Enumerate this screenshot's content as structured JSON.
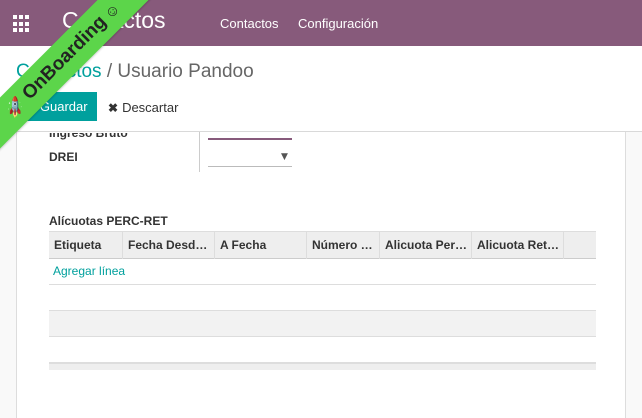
{
  "topbar": {
    "brand": "Contactos",
    "menu": [
      "Contactos",
      "Configuración"
    ]
  },
  "breadcrumb": {
    "parent": "Contactos",
    "separator": "/",
    "current": "Usuario Pandoo"
  },
  "actions": {
    "save_label": "Guardar",
    "discard_label": "Descartar"
  },
  "form": {
    "partial_field_label": "Ingreso Bruto",
    "drei_label": "DREI",
    "drei_value": ""
  },
  "section": {
    "title": "Alícuotas PERC-RET"
  },
  "grid": {
    "columns": [
      "Etiqueta",
      "Fecha Desd…",
      "A Fecha",
      "Número …",
      "Alicuota Per…",
      "Alicuota Ret…"
    ],
    "add_line": "Agregar línea"
  },
  "ribbon": {
    "label": "OnBoarding"
  },
  "colors": {
    "brand": "#875a7b",
    "accent": "#00a09d",
    "ribbon": "#5cd54a"
  }
}
